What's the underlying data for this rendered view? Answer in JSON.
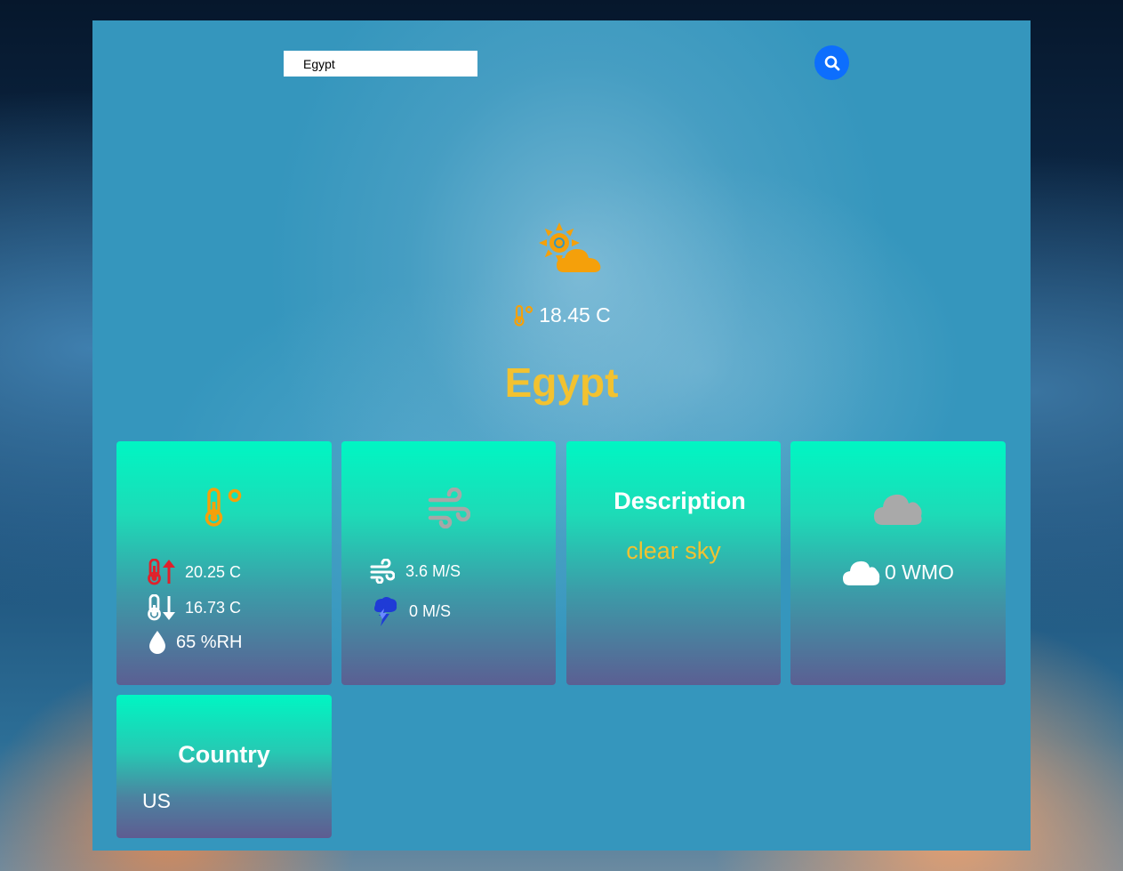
{
  "search": {
    "value": "Egypt",
    "placeholder": ""
  },
  "current": {
    "icon": "sun-cloud-icon",
    "temperature": "18.45 C",
    "city": "Egypt"
  },
  "cards": {
    "temperature": {
      "icon": "thermometer-icon",
      "max_temp": "20.25 C",
      "min_temp": "16.73 C",
      "humidity": "65 %RH"
    },
    "wind": {
      "icon": "wind-icon",
      "speed": "3.6 M/S",
      "gust": "0 M/S"
    },
    "description": {
      "title": "Description",
      "value": "clear sky"
    },
    "clouds": {
      "icon": "cloud-icon",
      "value": "0 WMO"
    },
    "country": {
      "title": "Country",
      "value": "US"
    }
  },
  "colors": {
    "accent_yellow": "#f2c230",
    "search_button": "#0d6efd",
    "card_top": "#00f6c3",
    "card_bottom": "#5b5f93",
    "panel": "#3596bd",
    "max_temp_icon": "#e0212b",
    "gust_icon": "#1f3bd6"
  }
}
